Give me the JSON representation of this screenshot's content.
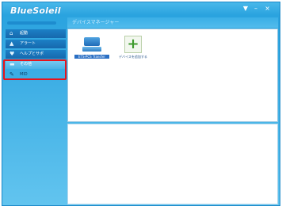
{
  "app": {
    "logo": "BlueSoleil"
  },
  "window_controls": {
    "options": "▼",
    "minimize": "–",
    "close": "×"
  },
  "sidebar": {
    "items": [
      {
        "label": "起動",
        "icon": "home-icon"
      },
      {
        "label": "アラート",
        "icon": "triangle-up-icon"
      },
      {
        "label": "ヘルプとサポ",
        "icon": "heart-icon"
      },
      {
        "label": "その他",
        "icon": "folder-icon",
        "active": true
      },
      {
        "label": "MID",
        "icon": "device-icon"
      }
    ]
  },
  "main": {
    "title": "デバイスマネージャー",
    "devices": [
      {
        "label": "ETS-PCS Transfer",
        "icon": "computer-icon",
        "selected": true
      },
      {
        "label": "デバイスを追加する",
        "icon": "add-icon"
      }
    ]
  },
  "colors": {
    "highlight": "#e6141c",
    "window": "#2aa3df"
  }
}
